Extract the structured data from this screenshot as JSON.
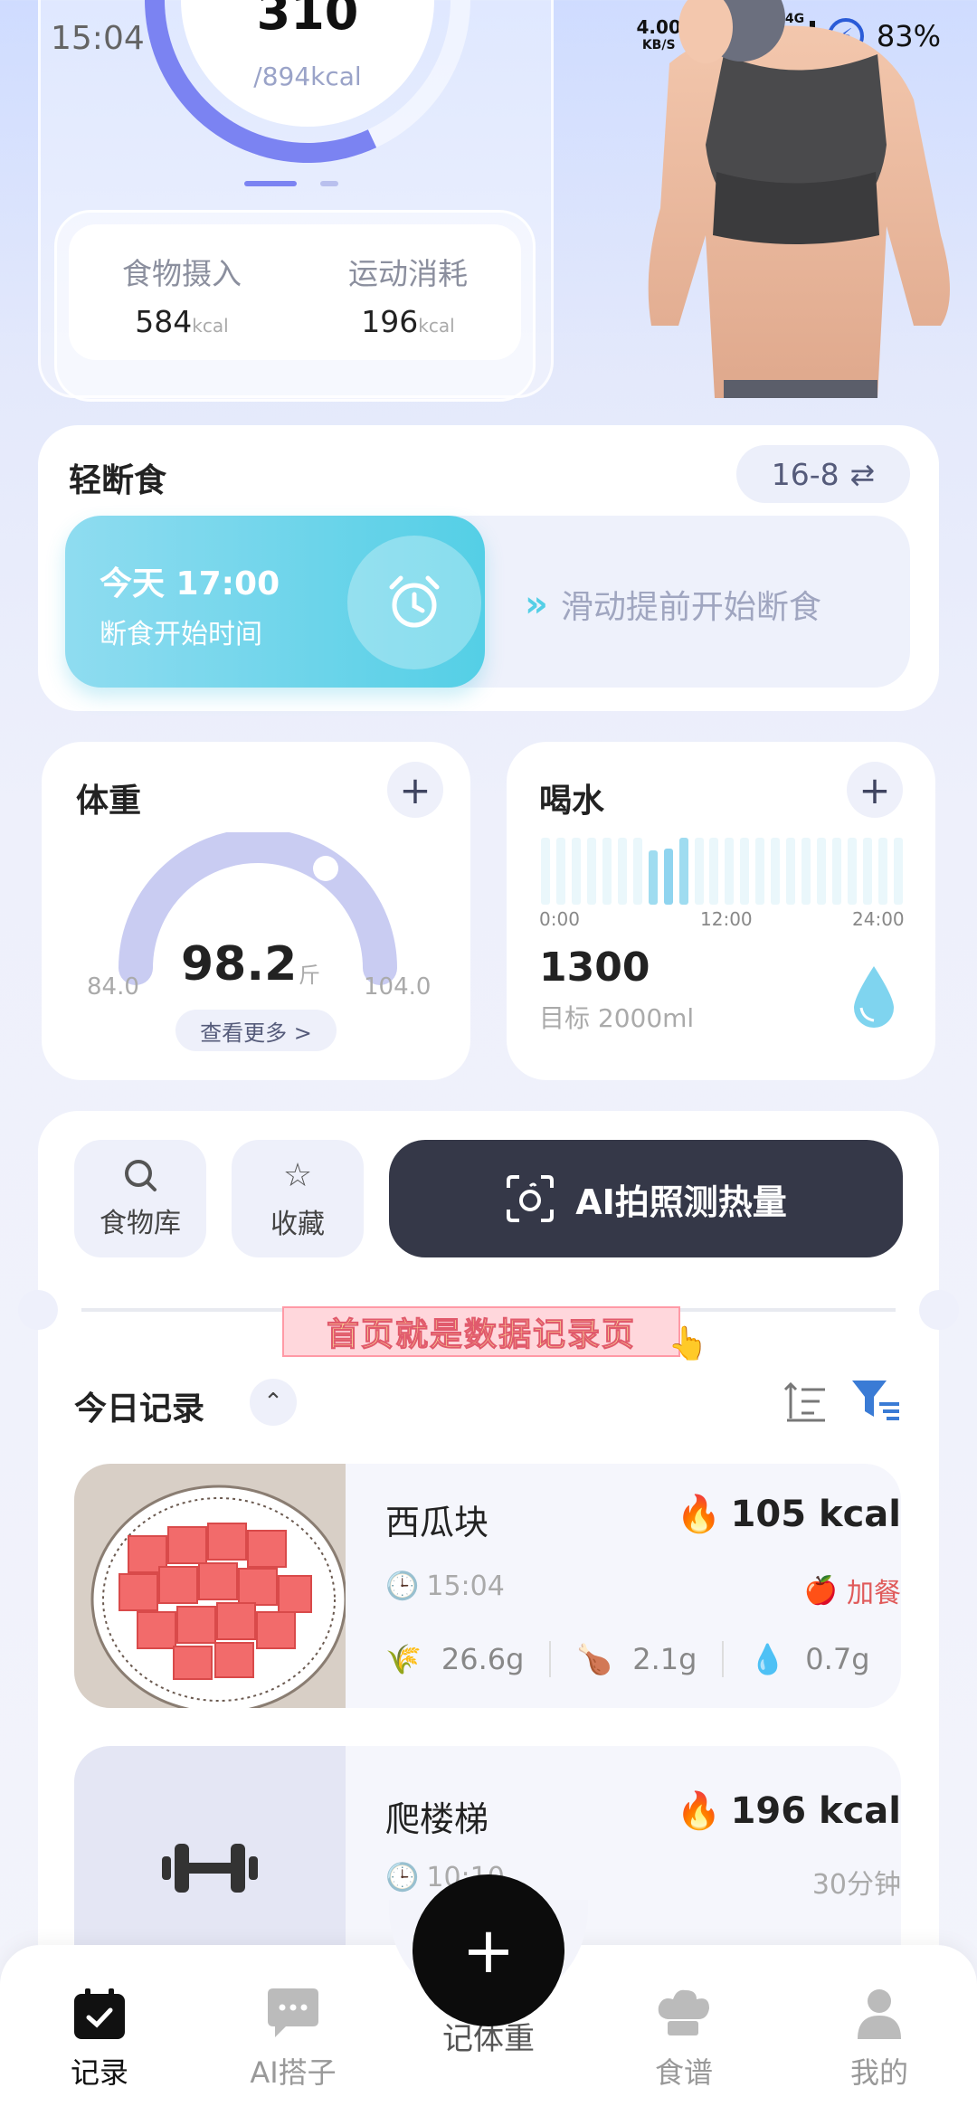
{
  "status_bar": {
    "time": "15:04",
    "net_speed_value": "4.00",
    "net_speed_unit": "KB/S",
    "sig1_label": "5G",
    "sig2_label": "4G",
    "battery": "83%"
  },
  "calories": {
    "remaining": "310",
    "target": "/894kcal",
    "food_label": "食物摄入",
    "food_value": "584",
    "exercise_label": "运动消耗",
    "exercise_value": "196",
    "unit": "kcal"
  },
  "fasting": {
    "title": "轻断食",
    "mode": "16-8",
    "start_time": "今天 17:00",
    "start_label": "断食开始时间",
    "slide_hint": "滑动提前开始断食"
  },
  "weight": {
    "title": "体重",
    "value": "98.2",
    "unit": "斤",
    "min": "84.0",
    "max": "104.0",
    "more": "查看更多 >"
  },
  "water": {
    "title": "喝水",
    "axis_start": "0:00",
    "axis_mid": "12:00",
    "axis_end": "24:00",
    "value": "1300",
    "goal": "目标 2000ml"
  },
  "actions": {
    "food_library": "食物库",
    "favorites": "收藏",
    "ai_photo": "AI拍照测热量"
  },
  "banner": "首页就是数据记录页",
  "today": {
    "title": "今日记录",
    "records": [
      {
        "name": "西瓜块",
        "kcal": "105 kcal",
        "time": "15:04",
        "tag": "加餐",
        "carbs": "26.6g",
        "protein": "2.1g",
        "fat": "0.7g"
      },
      {
        "name": "爬楼梯",
        "kcal": "196 kcal",
        "time": "10:10",
        "duration": "30分钟"
      }
    ]
  },
  "nav": {
    "record": "记录",
    "ai_buddy": "AI搭子",
    "center": "记体重",
    "recipes": "食谱",
    "mine": "我的"
  },
  "colors": {
    "accent_purple": "#7b83f2",
    "fasting_cyan": "#54cfe6",
    "dark_button": "#353848",
    "tag_red": "#e05a5a"
  }
}
